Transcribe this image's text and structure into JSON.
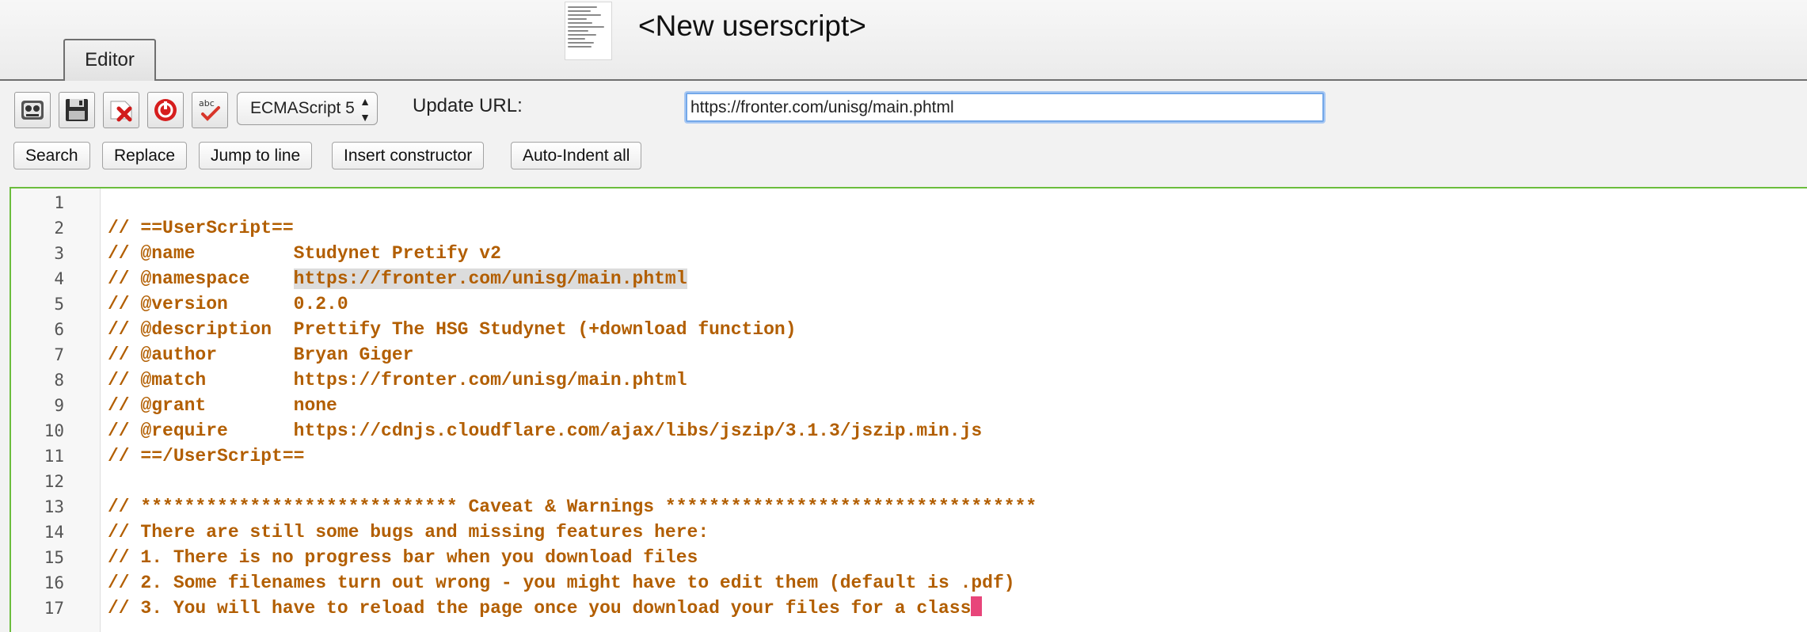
{
  "header": {
    "script_title": "<New userscript>",
    "tab_editor": "Editor"
  },
  "toolbar": {
    "tool_icons": [
      "tampermonkey-icon",
      "save-icon",
      "close-icon",
      "reset-icon",
      "spellcheck-icon"
    ],
    "spellcheck_icon_text": "abc",
    "language_value": "ECMAScript 5",
    "update_url_label": "Update URL:",
    "update_url_value": "https://fronter.com/unisg/main.phtml",
    "buttons": {
      "search": "Search",
      "replace": "Replace",
      "jump_to_line": "Jump to line",
      "insert_constructor": "Insert constructor",
      "auto_indent_all": "Auto-Indent all"
    }
  },
  "editor": {
    "highlight_text": "https://fronter.com/unisg/main.phtml",
    "lines": [
      {
        "num": "1",
        "text": ""
      },
      {
        "num": "2",
        "text": "// ==UserScript=="
      },
      {
        "num": "3",
        "text": "// @name         Studynet Pretify v2"
      },
      {
        "num": "4",
        "text": "// @namespace    https://fronter.com/unisg/main.phtml"
      },
      {
        "num": "5",
        "text": "// @version      0.2.0"
      },
      {
        "num": "6",
        "text": "// @description  Prettify The HSG Studynet (+download function)"
      },
      {
        "num": "7",
        "text": "// @author       Bryan Giger"
      },
      {
        "num": "8",
        "text": "// @match        https://fronter.com/unisg/main.phtml"
      },
      {
        "num": "9",
        "text": "// @grant        none"
      },
      {
        "num": "10",
        "text": "// @require      https://cdnjs.cloudflare.com/ajax/libs/jszip/3.1.3/jszip.min.js"
      },
      {
        "num": "11",
        "text": "// ==/UserScript=="
      },
      {
        "num": "12",
        "text": ""
      },
      {
        "num": "13",
        "text": "// ***************************** Caveat & Warnings **********************************"
      },
      {
        "num": "14",
        "text": "// There are still some bugs and missing features here:"
      },
      {
        "num": "15",
        "text": "// 1. There is no progress bar when you download files"
      },
      {
        "num": "16",
        "text": "// 2. Some filenames turn out wrong - you might have to edit them (default is .pdf)"
      },
      {
        "num": "17",
        "text": "// 3. You will have to reload the page once you download your files for a class"
      }
    ]
  }
}
